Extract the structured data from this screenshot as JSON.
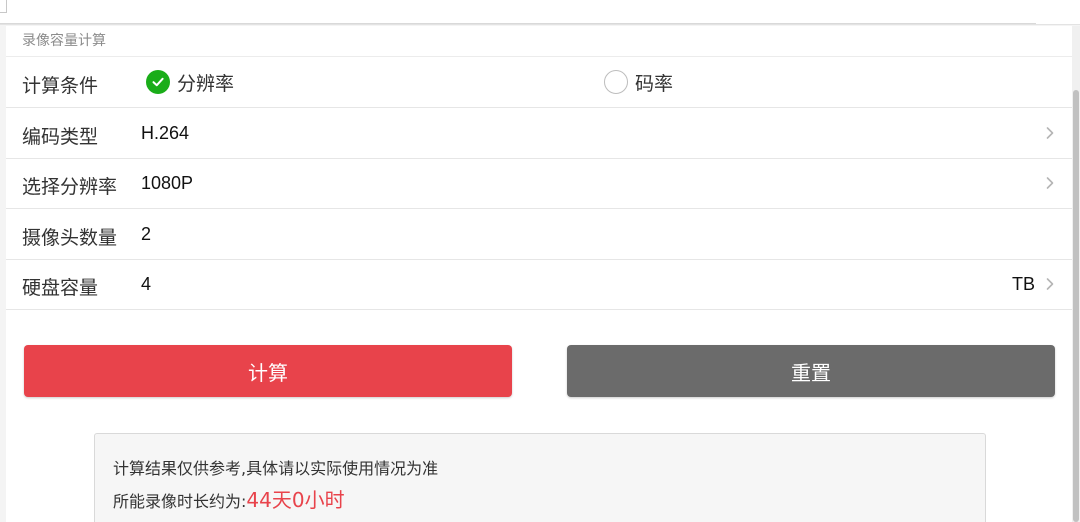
{
  "section_title": "录像容量计算",
  "condition": {
    "label": "计算条件",
    "options": [
      {
        "label": "分辨率",
        "selected": true
      },
      {
        "label": "码率",
        "selected": false
      }
    ]
  },
  "rows": [
    {
      "label": "编码类型",
      "value": "H.264"
    },
    {
      "label": "选择分辨率",
      "value": "1080P"
    },
    {
      "label": "摄像头数量",
      "value": "2"
    },
    {
      "label": "硬盘容量",
      "value": "4",
      "unit": "TB"
    }
  ],
  "buttons": {
    "calculate": "计算",
    "reset": "重置"
  },
  "result": {
    "note": "计算结果仅供参考,具体请以实际使用情况为准",
    "prefix": "所能录像时长约为:",
    "value": "44天0小时"
  },
  "colors": {
    "primary": "#e8434b",
    "secondary": "#6b6b6b",
    "selected": "#1aad19",
    "result_text": "#e8434b"
  },
  "icons": {
    "selected_radio": "check-circle-icon",
    "unselected_radio": "empty-circle-icon",
    "row_arrow": "chevron-right-icon"
  }
}
